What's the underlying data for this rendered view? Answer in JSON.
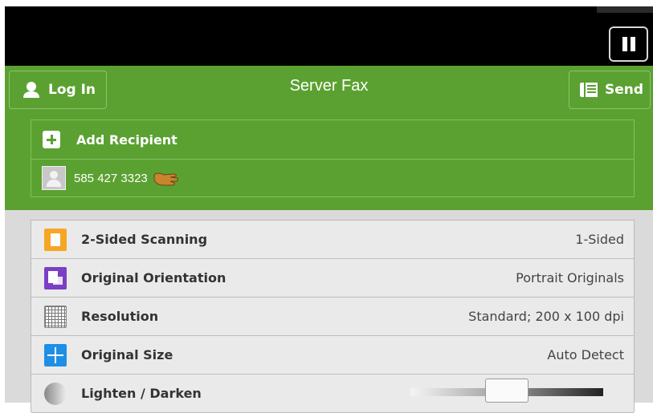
{
  "header": {
    "title": "Server Fax",
    "login_label": "Log In",
    "send_label": "Send"
  },
  "recipients": {
    "add_label": "Add Recipient",
    "items": [
      {
        "number": "585 427 3323"
      }
    ]
  },
  "settings": [
    {
      "label": "2-Sided Scanning",
      "value": "1-Sided",
      "icon": "two-sided-scan-icon"
    },
    {
      "label": "Original Orientation",
      "value": "Portrait Originals",
      "icon": "orientation-icon"
    },
    {
      "label": "Resolution",
      "value": "Standard; 200 x 100 dpi",
      "icon": "resolution-grid-icon"
    },
    {
      "label": "Original Size",
      "value": "Auto Detect",
      "icon": "size-arrows-icon"
    },
    {
      "label": "Lighten / Darken",
      "value": "",
      "icon": "contrast-icon"
    }
  ],
  "colors": {
    "header_green": "#5ba131",
    "list_bg": "#e9e9e9",
    "topbar": "#000000"
  }
}
